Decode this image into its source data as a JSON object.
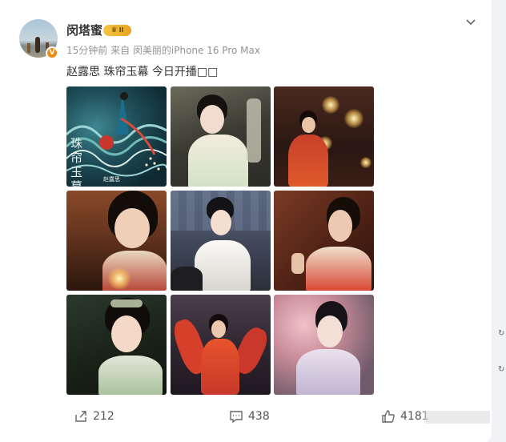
{
  "post": {
    "author": "闵塔蜜",
    "level_badge": "II",
    "verified_badge": "V",
    "meta": "15分钟前  来自 闵美丽的iPhone 16 Pro Max",
    "text": "赵露思 珠帘玉幕 今日开播□□",
    "poster_title": "珠帘玉幕",
    "poster_caption": "赵露思"
  },
  "photos": [
    {
      "id": "photo-1",
      "desc": "poster"
    },
    {
      "id": "photo-2",
      "desc": "green-dress"
    },
    {
      "id": "photo-3",
      "desc": "dancer-candles"
    },
    {
      "id": "photo-4",
      "desc": "closeup-candle"
    },
    {
      "id": "photo-5",
      "desc": "white-robe"
    },
    {
      "id": "photo-6",
      "desc": "red-dress-profile"
    },
    {
      "id": "photo-7",
      "desc": "smile-headdress"
    },
    {
      "id": "photo-8",
      "desc": "dance-red"
    },
    {
      "id": "photo-9",
      "desc": "blossom-lavender"
    }
  ],
  "actions": {
    "share_count": "212",
    "comment_count": "438",
    "like_count": "4181"
  },
  "colors": {
    "accent": "#f08a10",
    "text": "#333333",
    "meta": "#939393"
  },
  "icons": [
    "more-chevron-icon",
    "share-icon",
    "comment-icon",
    "like-icon"
  ]
}
